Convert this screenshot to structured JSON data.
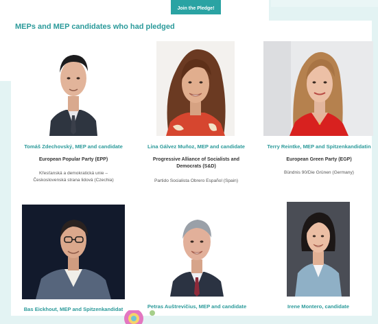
{
  "header": {
    "join_label": "Join the Pledge!",
    "section_title": "MEPs and MEP candidates who had pledged"
  },
  "candidates": [
    {
      "name": "Tomáš Zdechovský, MEP and candidate",
      "party": "European Popular Party (EPP)",
      "national_party": "Křesťanská a demokratická unie – Československá strana lidová (Czechia)"
    },
    {
      "name": "Lina Gálvez Muñoz, MEP and candidate",
      "party": "Progressive Alliance of Socialists and Democrats (S&D)",
      "national_party": "Partido Socialista Obrero Español (Spain)"
    },
    {
      "name": "Terry Reintke, MEP and Spitzenkandidatin",
      "party": "European Green Party (EGP)",
      "national_party": "Bündnis 90/Die Grünen (Germany)"
    },
    {
      "name": "Bas Eickhout, MEP and Spitzenkandidat",
      "party": "",
      "national_party": ""
    },
    {
      "name": "Petras Auštrevičius, MEP and candidate",
      "party": "",
      "national_party": ""
    },
    {
      "name": "Irene Montero, candidate",
      "party": "",
      "national_party": ""
    }
  ],
  "colors": {
    "accent": "#2b9a9a",
    "button": "#2aa3a3",
    "page_background": "#e3f3f3"
  }
}
